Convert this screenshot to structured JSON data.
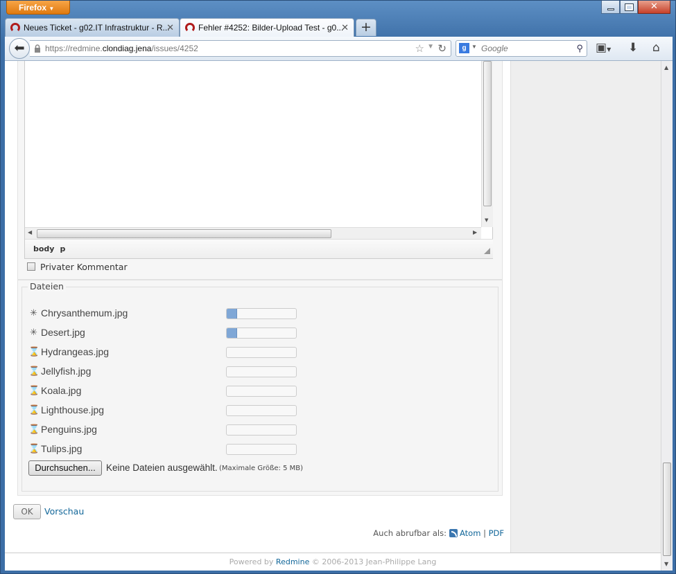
{
  "browser": {
    "app_button": "Firefox",
    "tabs": [
      {
        "title": "Neues Ticket - g02.IT Infrastruktur - R..."
      },
      {
        "title": "Fehler #4252: Bilder-Upload Test - g0..."
      }
    ],
    "url_prefix": "https://redmine.",
    "url_host": "clondiag.jena",
    "url_path": "/issues/4252",
    "search_placeholder": "Google"
  },
  "editor": {
    "status_path": [
      "body",
      "p"
    ]
  },
  "private_comment_label": "Privater Kommentar",
  "files": {
    "legend": "Dateien",
    "items": [
      {
        "name": "Chrysanthemum.jpg",
        "state": "uploading",
        "progress": 0.15
      },
      {
        "name": "Desert.jpg",
        "state": "uploading",
        "progress": 0.15
      },
      {
        "name": "Hydrangeas.jpg",
        "state": "waiting",
        "progress": 0
      },
      {
        "name": "Jellyfish.jpg",
        "state": "waiting",
        "progress": 0
      },
      {
        "name": "Koala.jpg",
        "state": "waiting",
        "progress": 0
      },
      {
        "name": "Lighthouse.jpg",
        "state": "waiting",
        "progress": 0
      },
      {
        "name": "Penguins.jpg",
        "state": "waiting",
        "progress": 0
      },
      {
        "name": "Tulips.jpg",
        "state": "waiting",
        "progress": 0
      }
    ],
    "browse_label": "Durchsuchen...",
    "no_files_label": "Keine Dateien ausgewählt.",
    "max_size_label": "(Maximale Größe: 5 MB)"
  },
  "actions": {
    "ok_label": "OK",
    "preview_label": "Vorschau"
  },
  "also_available": {
    "label": "Auch abrufbar als:",
    "atom": "Atom",
    "separator": "|",
    "pdf": "PDF"
  },
  "footer": {
    "prefix": "Powered by",
    "link": "Redmine",
    "suffix": "© 2006-2013 Jean-Philippe Lang"
  },
  "colors": {
    "link": "#116699",
    "progress_fill": "#7fa7d6",
    "firefox_button": "#e8891f"
  }
}
